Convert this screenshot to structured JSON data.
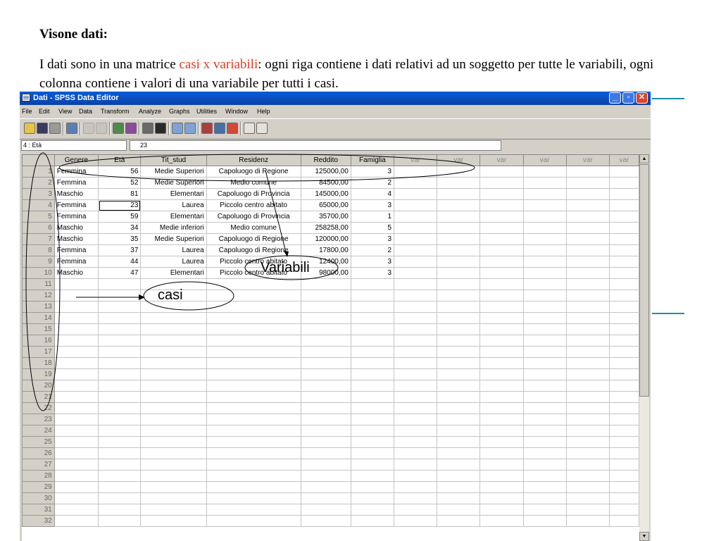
{
  "slide": {
    "heading": "Visone dati:",
    "intro_before": "I dati sono in una matrice ",
    "intro_highlight": "casi x variabili",
    "intro_after": ": ogni riga contiene i dati relativi ad un soggetto per tutte le variabili, ogni colonna contiene i valori di una variabile per tutti i casi."
  },
  "colors": {
    "highlight": "#e03c1f",
    "deco_line": "#1a8fa3",
    "titlebar": "#0a5cd8"
  },
  "window": {
    "title": "Dati - SPSS Data Editor",
    "menu": [
      "File",
      "Edit",
      "View",
      "Data",
      "Transform",
      "Analyze",
      "Graphs",
      "Utilities",
      "Window",
      "Help"
    ],
    "toolbar_icons": [
      "open-folder-icon",
      "save-icon",
      "print-icon",
      "dialog-recall-icon",
      "undo-icon",
      "redo-icon",
      "goto-chart-icon",
      "goto-case-icon",
      "variables-icon",
      "find-icon",
      "insert-case-icon",
      "insert-variable-icon",
      "split-file-icon",
      "weight-cases-icon",
      "select-cases-icon",
      "value-labels-icon",
      "use-sets-icon"
    ],
    "cell_ref": "4 : Età",
    "cell_value": "23"
  },
  "grid": {
    "columns": [
      "Genere",
      "Età",
      "Tit_stud",
      "Residenz",
      "Reddito",
      "Famiglia",
      "var",
      "var",
      "var",
      "var",
      "var",
      "var"
    ],
    "rows": [
      [
        "Femmina",
        "56",
        "Medie Superiori",
        "Capoluogo di Regione",
        "125000,00",
        "3"
      ],
      [
        "Femmina",
        "52",
        "Medie Superiori",
        "Medio comune",
        "84500,00",
        "2"
      ],
      [
        "Maschio",
        "81",
        "Elementari",
        "Capoluogo di Provincia",
        "145000,00",
        "4"
      ],
      [
        "Femmina",
        "23",
        "Laurea",
        "Piccolo centro abitato",
        "65000,00",
        "3"
      ],
      [
        "Femmina",
        "59",
        "Elementari",
        "Capoluogo di Provincia",
        "35700,00",
        "1"
      ],
      [
        "Maschio",
        "34",
        "Medie inferiori",
        "Medio comune",
        "258258,00",
        "5"
      ],
      [
        "Maschio",
        "35",
        "Medie Superiori",
        "Capoluogo di Regione",
        "120000,00",
        "3"
      ],
      [
        "Femmina",
        "37",
        "Laurea",
        "Capoluogo di Regione",
        "17800,00",
        "2"
      ],
      [
        "Femmina",
        "44",
        "Laurea",
        "Piccolo centro abitato",
        "12400,00",
        "3"
      ],
      [
        "Maschio",
        "47",
        "Elementari",
        "Piccolo centro abitato",
        "98000,00",
        "3"
      ]
    ],
    "row_count": 32
  },
  "annotations": {
    "variables_label": "Variabili",
    "cases_label": "casi"
  }
}
